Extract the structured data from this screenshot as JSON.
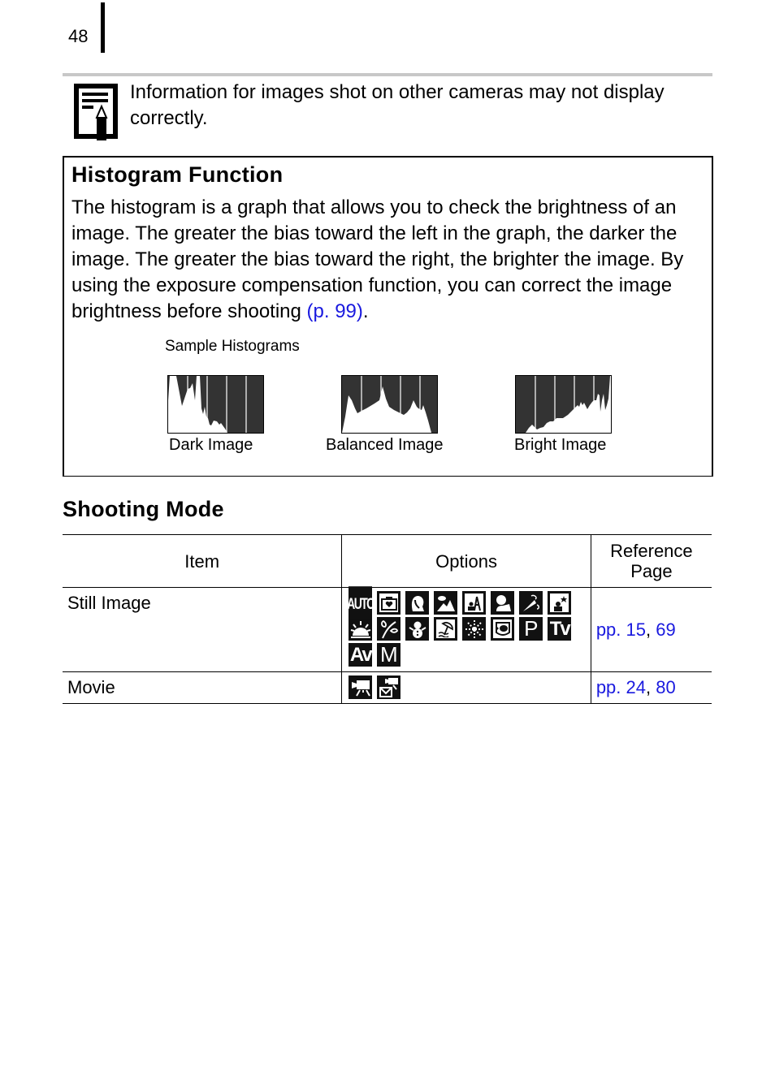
{
  "page": {
    "number": "48"
  },
  "note": {
    "icon": "note-pencil-icon",
    "text": "Information for images shot on other cameras may not display correctly."
  },
  "histogram_box": {
    "title": "Histogram Function",
    "body_text": "The histogram is a graph that allows you to check the brightness of an image. The greater the bias toward the left in the graph, the darker the image. The greater the bias toward the right, the brighter the image. By using the exposure compensation function, you can correct the image brightness before shooting ",
    "link_text": "(p. 99)",
    "trailing": ".",
    "sample_label": "Sample Histograms",
    "samples": [
      {
        "label": "Dark Image",
        "bias": "left"
      },
      {
        "label": "Balanced Image",
        "bias": "center"
      },
      {
        "label": "Bright Image",
        "bias": "right"
      }
    ]
  },
  "shooting_mode": {
    "title": "Shooting Mode",
    "headers": {
      "item": "Item",
      "options": "Options",
      "reference": "Reference Page"
    },
    "rows": [
      {
        "item": "Still Image",
        "options": [
          {
            "name": "auto-mode-icon",
            "label": "AUTO"
          },
          {
            "name": "my-colors-camera-icon",
            "label": ""
          },
          {
            "name": "portrait-icon",
            "label": ""
          },
          {
            "name": "landscape-icon",
            "label": ""
          },
          {
            "name": "night-snapshot-icon",
            "label": ""
          },
          {
            "name": "kids-pets-icon",
            "label": ""
          },
          {
            "name": "indoor-party-icon",
            "label": ""
          },
          {
            "name": "night-scene-icon",
            "label": ""
          },
          {
            "name": "sunset-icon",
            "label": ""
          },
          {
            "name": "foliage-icon",
            "label": ""
          },
          {
            "name": "snow-icon",
            "label": ""
          },
          {
            "name": "beach-icon",
            "label": ""
          },
          {
            "name": "fireworks-icon",
            "label": ""
          },
          {
            "name": "underwater-icon",
            "label": ""
          },
          {
            "name": "program-mode-icon",
            "label": "P"
          },
          {
            "name": "shutter-priority-icon",
            "label": "Tv"
          },
          {
            "name": "aperture-priority-icon",
            "label": "Av"
          },
          {
            "name": "manual-mode-icon",
            "label": "M"
          }
        ],
        "ref_prefix": "pp. ",
        "ref_pages": [
          "15",
          "69"
        ]
      },
      {
        "item": "Movie",
        "options": [
          {
            "name": "movie-standard-icon",
            "label": ""
          },
          {
            "name": "movie-email-icon",
            "label": ""
          }
        ],
        "ref_prefix": "pp. ",
        "ref_pages": [
          "24",
          "80"
        ]
      }
    ]
  },
  "colors": {
    "link": "#1a1adf",
    "histogram_bg": "#333333",
    "rule": "#c8c8c8"
  }
}
